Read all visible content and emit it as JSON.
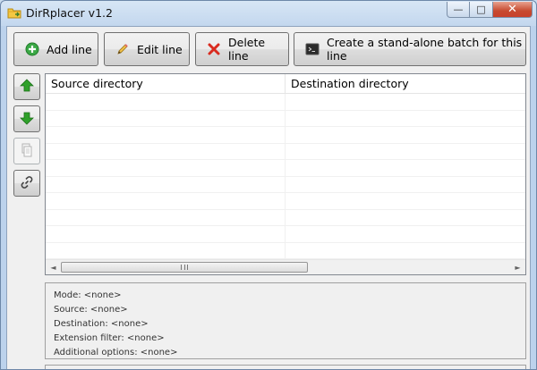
{
  "window": {
    "title": "DirRplacer v1.2",
    "controls": {
      "minimize": "—",
      "maximize": "□",
      "close": "✕"
    }
  },
  "toolbar": {
    "add_label": "Add line",
    "edit_label": "Edit line",
    "delete_label": "Delete line",
    "batch_label": "Create a stand-alone batch for this line"
  },
  "side_buttons": [
    {
      "icon": "arrow-up-icon",
      "enabled": true
    },
    {
      "icon": "arrow-down-icon",
      "enabled": true
    },
    {
      "icon": "copy-icon",
      "enabled": false
    },
    {
      "icon": "link-icon",
      "enabled": true
    }
  ],
  "list": {
    "columns": [
      "Source directory",
      "Destination directory"
    ],
    "rows": []
  },
  "scrollbar": {
    "left_arrow": "◄",
    "right_arrow": "►"
  },
  "info": {
    "mode": "Mode: <none>",
    "source": "Source: <none>",
    "destination": "Destination: <none>",
    "extension_filter": "Extension filter: <none>",
    "additional_options": "Additional options: <none>"
  },
  "colors": {
    "add_green": "#3aa845",
    "delete_red": "#d92b1f",
    "arrow_green": "#2fa12a",
    "titlebar": "#c3d7ee"
  }
}
